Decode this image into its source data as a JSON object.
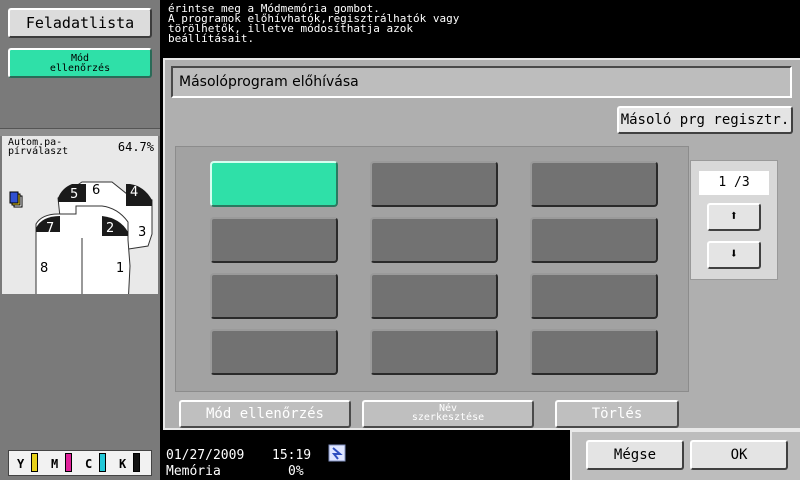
{
  "sidebar": {
    "job_list_label": "Feladatlista",
    "mode_check_label": "Mód ellenőrzés",
    "paper_label": "Autom.pa-\npírválaszt",
    "zoom_value": "64.7%",
    "page_numbers": [
      "6",
      "5",
      "4",
      "2",
      "7",
      "3",
      "8",
      "1"
    ],
    "toner": [
      {
        "label": "Y",
        "color": "#e8d21a"
      },
      {
        "label": "M",
        "color": "#e0209a"
      },
      {
        "label": "C",
        "color": "#22c8d8"
      },
      {
        "label": "K",
        "color": "#111111"
      }
    ]
  },
  "message": {
    "text": "érintse meg a Módmemória gombot.\nA programok előhívhatók,regisztrálhatók vagy\ntörölhetők, illetve módosíthatja azok\nbeállításait."
  },
  "panel": {
    "title": "Másolóprogram előhívása",
    "register_label": "Másoló prg regisztr.",
    "page_indicator": "1 /3",
    "up_arrow": "⬆",
    "down_arrow": "⬇",
    "programs_selected_index": 0,
    "mode_check_btn": "Mód ellenőrzés",
    "edit_name_btn": "Név\nszerkesztése",
    "delete_btn": "Törlés"
  },
  "status": {
    "date": "01/27/2009",
    "time": "15:19",
    "memory_label": "Memória",
    "memory_value": "0%"
  },
  "dialog": {
    "cancel_label": "Mégse",
    "ok_label": "OK"
  },
  "colors": {
    "accent": "#2fe0a8",
    "panel_bg": "#afafaf",
    "program_slot": "#727272"
  }
}
